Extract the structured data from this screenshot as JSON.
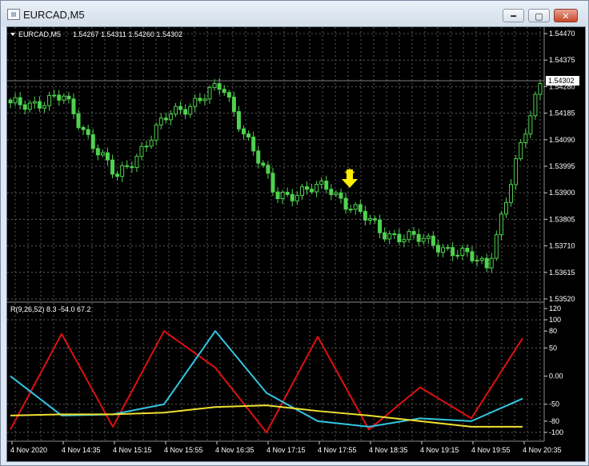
{
  "window": {
    "title": "EURCAD,M5",
    "buttons": {
      "minimize": "━",
      "maximize": "▢",
      "close": "✕"
    }
  },
  "header": {
    "symbol": "EURCAD,M5",
    "ohlc": "1.54267 1.54311 1.54260 1.54302"
  },
  "price_axis": {
    "ticks": [
      "1.54470",
      "1.54375",
      "1.54280",
      "1.54185",
      "1.54090",
      "1.53995",
      "1.53900",
      "1.53805",
      "1.53710",
      "1.53615",
      "1.53520"
    ],
    "current_price": "1.54302"
  },
  "indicator": {
    "label": "R(9,26,52) 8.3 -54.0 67.2",
    "ticks": [
      "120",
      "100",
      "80",
      "50",
      "0.00",
      "-50",
      "-80",
      "-100"
    ]
  },
  "time_axis": {
    "labels": [
      "4 Nov 2020",
      "4 Nov 14:35",
      "4 Nov 15:15",
      "4 Nov 15:55",
      "4 Nov 16:35",
      "4 Nov 17:15",
      "4 Nov 17:55",
      "4 Nov 18:35",
      "4 Nov 19:15",
      "4 Nov 19:55",
      "4 Nov 20:35"
    ]
  },
  "colors": {
    "background": "#000000",
    "grid": "#5a5a5a",
    "candle": "#4fd24f",
    "line_fast": "#e01010",
    "line_mid": "#34c6e2",
    "line_slow": "#f0e030",
    "signal": "#ffee00"
  },
  "icons": {
    "signal_star": "star-icon",
    "signal_arrow": "down-arrow-icon",
    "menu": "triangle-down-icon"
  },
  "chart_data": [
    {
      "type": "candlestick",
      "title": "EURCAD,M5",
      "ylim": [
        1.5352,
        1.5447
      ],
      "x": [
        "4 Nov 2020",
        "4 Nov 14:35",
        "4 Nov 15:15",
        "4 Nov 15:55",
        "4 Nov 16:35",
        "4 Nov 17:15",
        "4 Nov 17:55",
        "4 Nov 18:35",
        "4 Nov 19:15",
        "4 Nov 19:55",
        "4 Nov 20:35"
      ],
      "close_approx": [
        1.5421,
        1.5424,
        1.5395,
        1.5418,
        1.5428,
        1.5389,
        1.5392,
        1.5376,
        1.5372,
        1.5364,
        1.543
      ]
    },
    {
      "type": "line",
      "ylim": [
        -110,
        120
      ],
      "x": [
        "4 Nov 2020",
        "4 Nov 14:35",
        "4 Nov 15:15",
        "4 Nov 15:55",
        "4 Nov 16:35",
        "4 Nov 17:15",
        "4 Nov 17:55",
        "4 Nov 18:35",
        "4 Nov 19:15",
        "4 Nov 19:55",
        "4 Nov 20:35"
      ],
      "series": [
        {
          "values": [
            -95,
            75,
            -90,
            80,
            15,
            -100,
            70,
            -95,
            -20,
            -75,
            67.2
          ]
        },
        {
          "values": [
            0,
            -70,
            -68,
            -50,
            80,
            -30,
            -80,
            -90,
            -75,
            -80,
            -40
          ]
        },
        {
          "values": [
            -70,
            -68,
            -68,
            -65,
            -55,
            -52,
            -62,
            -70,
            -80,
            -90,
            -90
          ]
        }
      ]
    }
  ]
}
